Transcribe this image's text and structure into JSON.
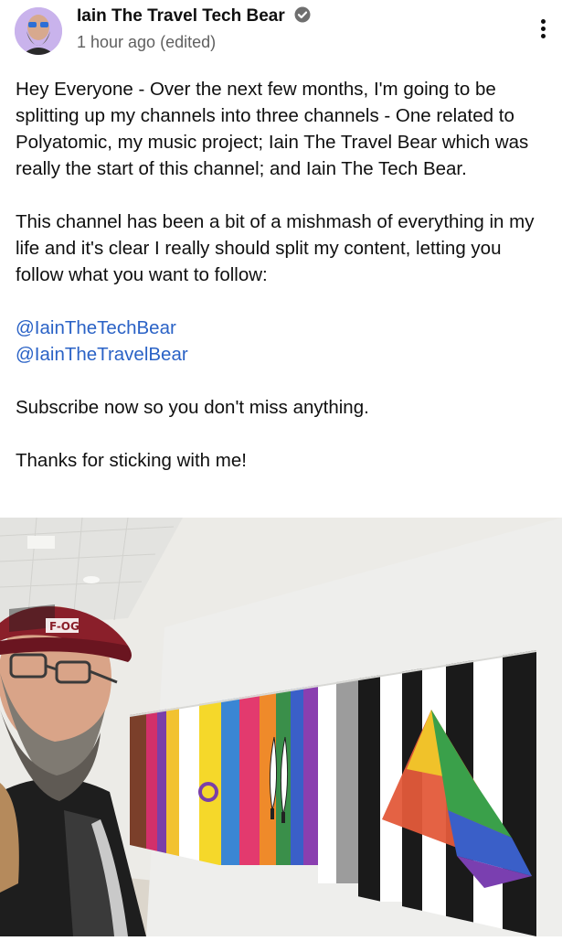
{
  "post": {
    "author": "Iain The Travel Tech Bear",
    "time": "1 hour ago (edited)",
    "paragraph1": "Hey Everyone - Over the next few months, I'm going to be splitting up my channels into three channels - One related to Polyatomic, my music project; Iain The Travel Bear which was really the start of this channel; and Iain The Tech Bear.",
    "paragraph2": "This channel has been a bit of a mishmash of everything in my life and it's clear I really should split my content, letting you follow what you want to follow:",
    "links": [
      "@IainTheTechBear",
      "@IainTheTravelBear"
    ],
    "paragraph3": "Subscribe now so you don't miss anything.",
    "paragraph4": "Thanks for sticking with me!",
    "cap_text": "F-OG"
  },
  "icons": {
    "verified": "verified-badge-icon",
    "more": "more-vert-icon"
  },
  "colors": {
    "link": "#2a62c6",
    "meta": "#606060",
    "text": "#0f0f0f"
  }
}
